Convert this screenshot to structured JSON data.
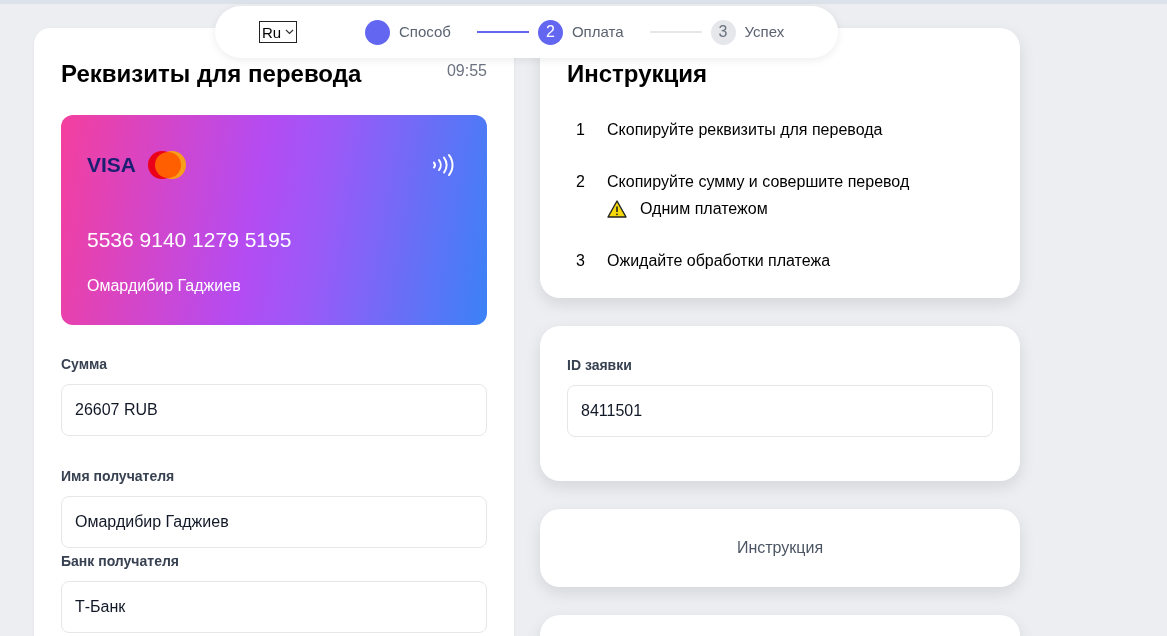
{
  "language_select": {
    "value": "Ru"
  },
  "stepper": [
    {
      "label": "Способ",
      "done": true,
      "selected": false
    },
    {
      "number": "2",
      "label": "Оплата",
      "done": false,
      "selected": true
    },
    {
      "number": "3",
      "label": "Успех",
      "done": false,
      "selected": false
    }
  ],
  "details_card": {
    "title": "Реквизиты для перевода",
    "timer": "09:55",
    "bank_card": {
      "brand": "VISA",
      "number": "5536 9140 1279 5195",
      "holder": "Омардибир Гаджиев"
    },
    "fields": [
      {
        "label": "Сумма",
        "value": "26607 RUB"
      },
      {
        "label": "Имя получателя",
        "value": "Омардибир Гаджиев"
      },
      {
        "label": "Банк получателя",
        "value": "Т-Банк"
      }
    ]
  },
  "instruction_card": {
    "title": "Инструкция",
    "steps": [
      {
        "number": "1",
        "text": "Скопируйте реквизиты для перевода"
      },
      {
        "number": "2",
        "text": "Скопируйте сумму и совершите перевод",
        "warning": "Одним платежом"
      },
      {
        "number": "3",
        "text": "Ожидайте обработки платежа"
      }
    ]
  },
  "request_card": {
    "label": "ID заявки",
    "value": "8411501"
  },
  "instruction_button": {
    "label": "Инструкция"
  }
}
